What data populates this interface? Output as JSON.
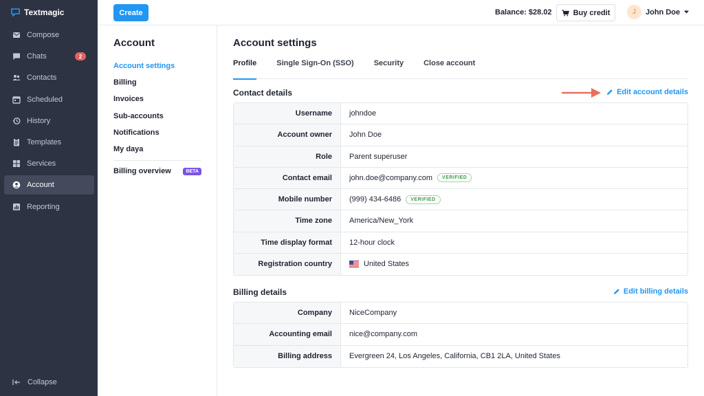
{
  "brand": {
    "name": "Textmagic"
  },
  "sidebar": {
    "items": [
      {
        "label": "Compose",
        "icon": "compose-icon"
      },
      {
        "label": "Chats",
        "icon": "chat-icon",
        "badge": "2"
      },
      {
        "label": "Contacts",
        "icon": "contacts-icon"
      },
      {
        "label": "Scheduled",
        "icon": "calendar-icon"
      },
      {
        "label": "History",
        "icon": "history-icon"
      },
      {
        "label": "Templates",
        "icon": "template-icon"
      },
      {
        "label": "Services",
        "icon": "services-icon"
      },
      {
        "label": "Account",
        "icon": "account-icon",
        "active": true
      },
      {
        "label": "Reporting",
        "icon": "reporting-icon"
      }
    ],
    "collapse_label": "Collapse"
  },
  "topbar": {
    "create_label": "Create",
    "balance": "Balance: $28.02",
    "buy_credit_label": "Buy credit",
    "user_initial": "J",
    "user_name": "John Doe"
  },
  "subnav": {
    "title": "Account",
    "items": [
      {
        "label": "Account settings",
        "active": true
      },
      {
        "label": "Billing"
      },
      {
        "label": "Invoices"
      },
      {
        "label": "Sub-accounts"
      },
      {
        "label": "Notifications"
      },
      {
        "label": "My daya"
      }
    ],
    "billing_overview": "Billing overview",
    "beta_badge": "BETA"
  },
  "main": {
    "title": "Account settings",
    "tabs": [
      {
        "label": "Profile",
        "active": true
      },
      {
        "label": "Single Sign-On (SSO)"
      },
      {
        "label": "Security"
      },
      {
        "label": "Close account"
      }
    ],
    "contact": {
      "title": "Contact details",
      "edit_label": "Edit account details",
      "rows": [
        {
          "label": "Username",
          "value": "johndoe"
        },
        {
          "label": "Account owner",
          "value": "John Doe"
        },
        {
          "label": "Role",
          "value": "Parent superuser"
        },
        {
          "label": "Contact email",
          "value": "john.doe@company.com",
          "badge": "VERIFIED"
        },
        {
          "label": "Mobile number",
          "value": "(999) 434-6486",
          "badge": "VERIFIED"
        },
        {
          "label": "Time zone",
          "value": "America/New_York"
        },
        {
          "label": "Time display format",
          "value": "12-hour clock"
        },
        {
          "label": "Registration country",
          "value": "United States",
          "flag": "us-flag-icon"
        }
      ]
    },
    "billing": {
      "title": "Billing details",
      "edit_label": "Edit billing details",
      "rows": [
        {
          "label": "Company",
          "value": "NiceCompany"
        },
        {
          "label": "Accounting email",
          "value": "nice@company.com"
        },
        {
          "label": "Billing address",
          "value": "Evergreen 24, Los Angeles, California, CB1 2LA, United States"
        }
      ]
    }
  },
  "colors": {
    "sidebar_bg": "#2e3344",
    "accent": "#2196f3",
    "badge_red": "#e06262",
    "beta_purple": "#7a55e8",
    "verified_green": "#3c9a48",
    "arrow_red": "#e8705e"
  }
}
